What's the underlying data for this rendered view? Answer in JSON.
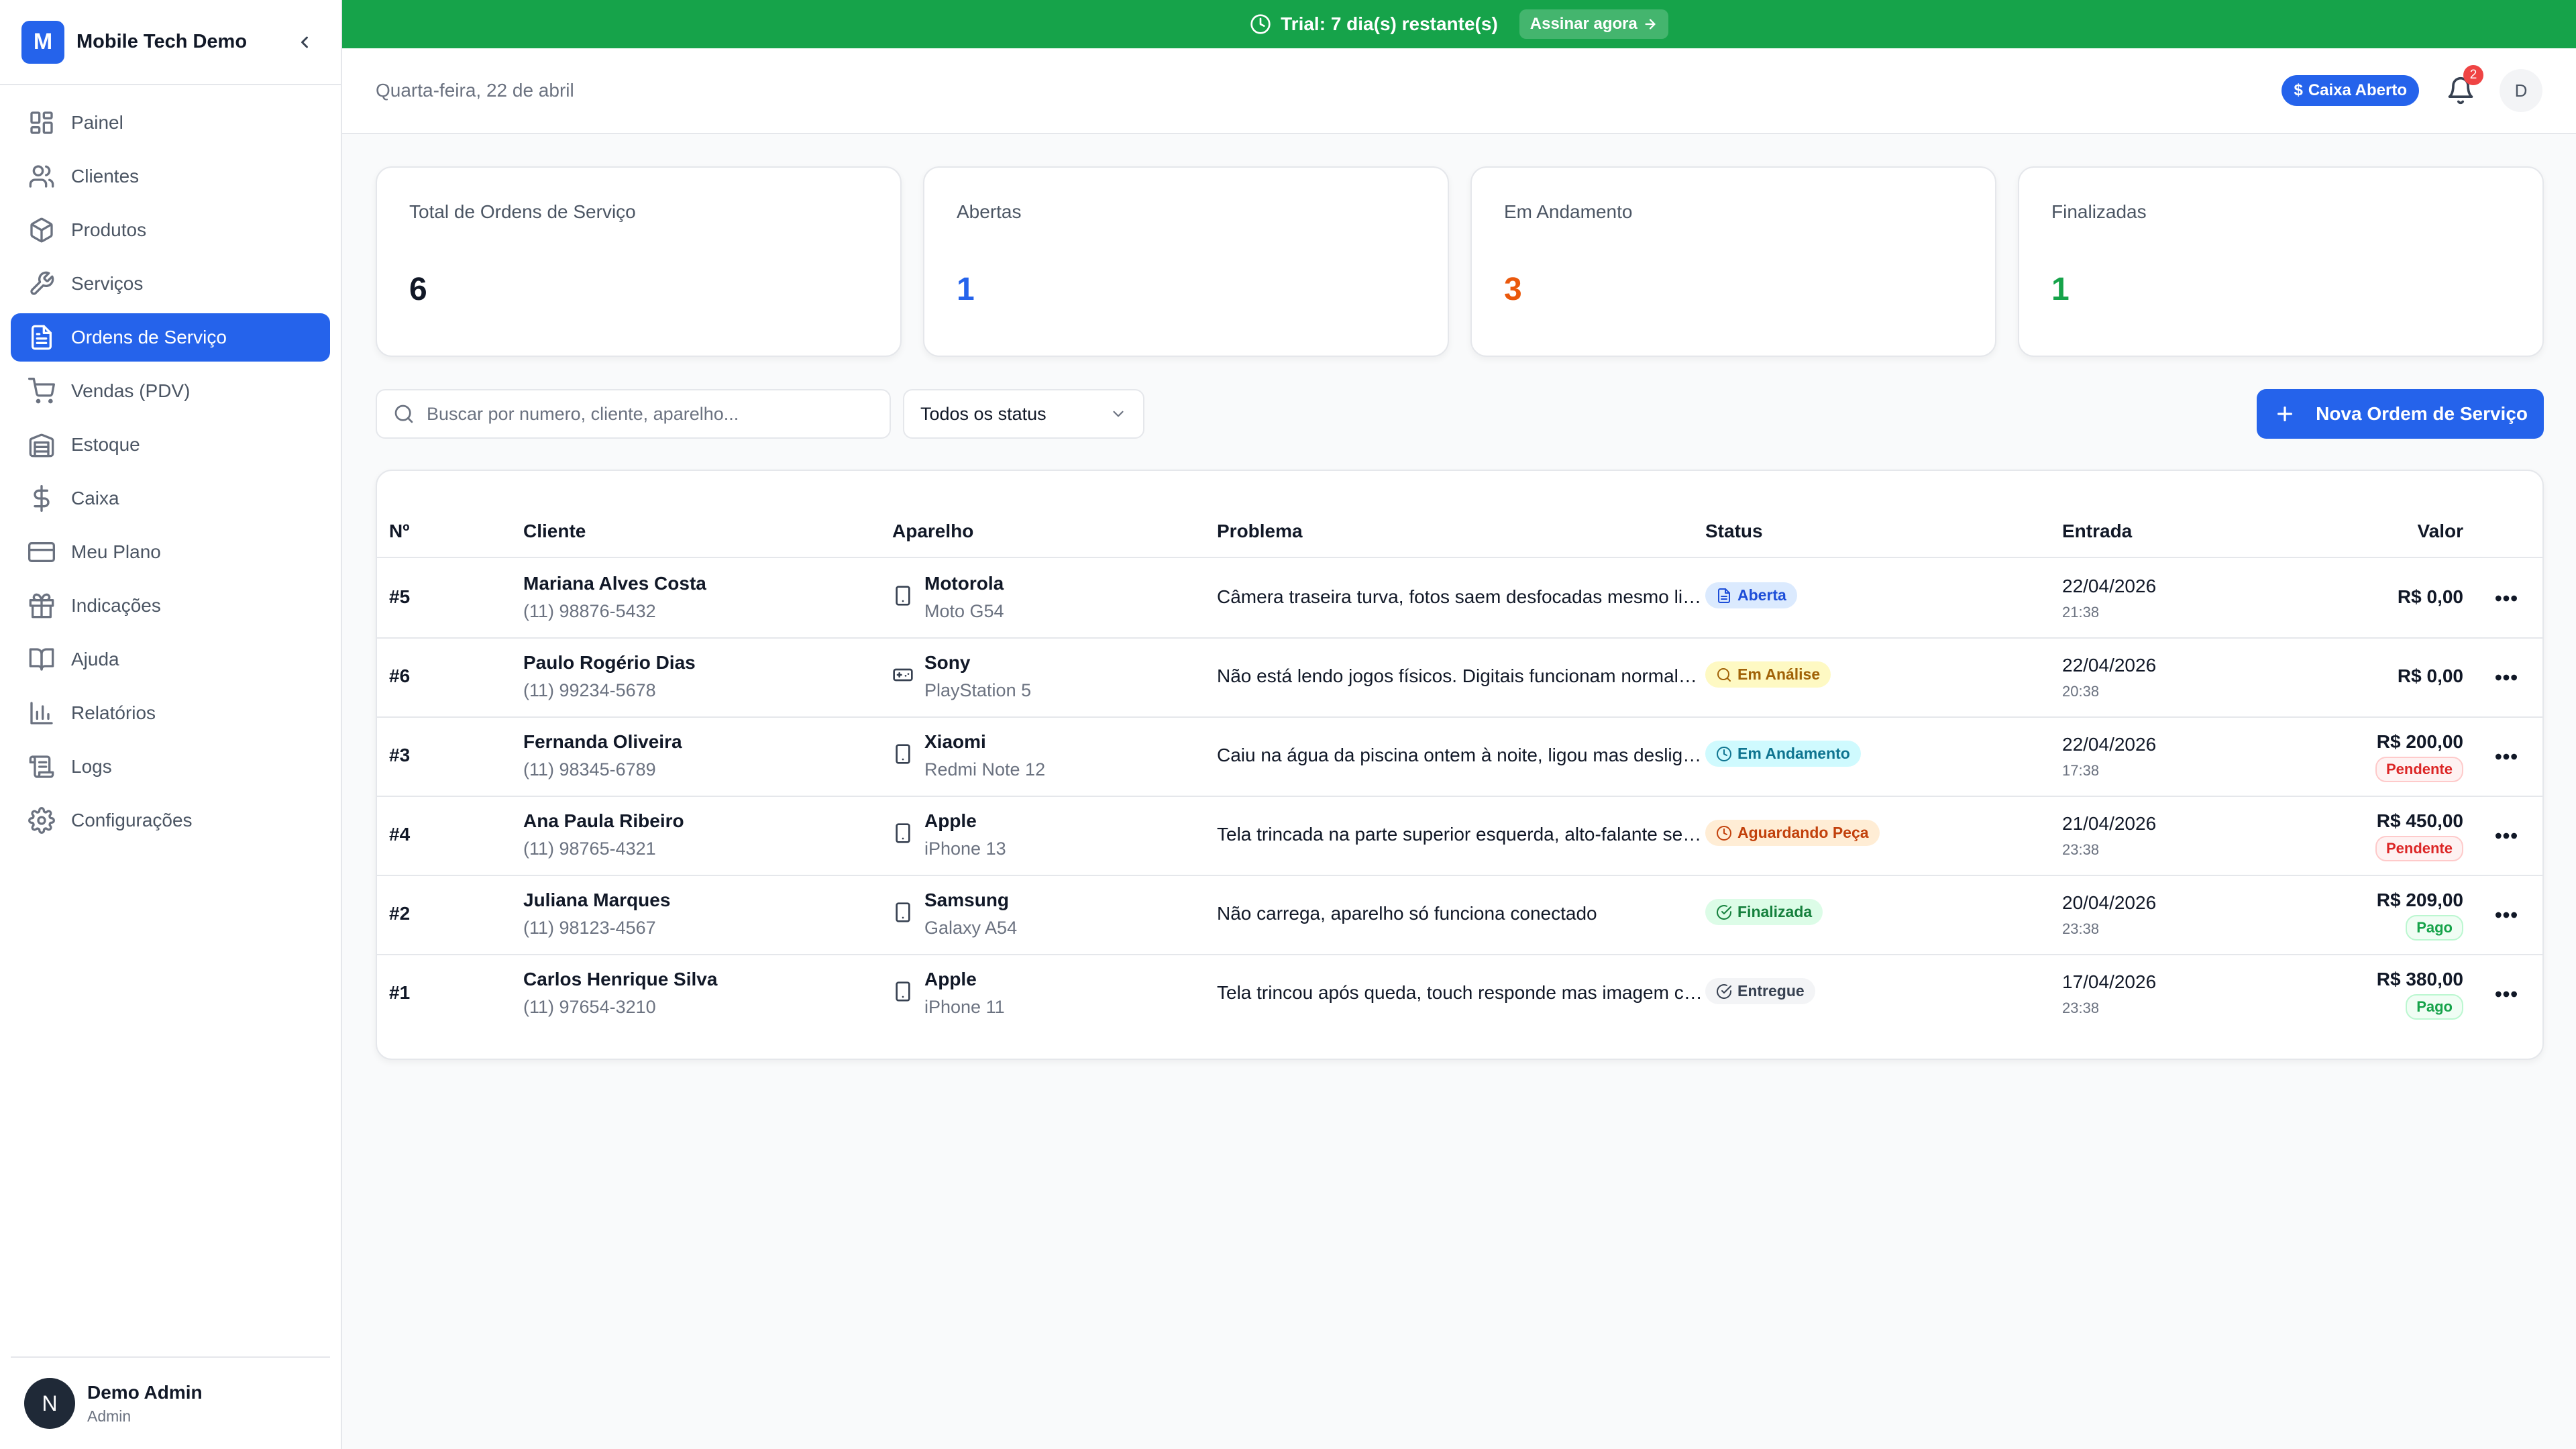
{
  "app": {
    "logo_letter": "M",
    "name": "Mobile Tech Demo"
  },
  "sidebar": {
    "items": [
      {
        "label": "Painel",
        "icon": "dashboard-icon"
      },
      {
        "label": "Clientes",
        "icon": "users-icon"
      },
      {
        "label": "Produtos",
        "icon": "package-icon"
      },
      {
        "label": "Serviços",
        "icon": "wrench-icon"
      },
      {
        "label": "Ordens de Serviço",
        "icon": "file-text-icon",
        "active": true
      },
      {
        "label": "Vendas (PDV)",
        "icon": "cart-icon"
      },
      {
        "label": "Estoque",
        "icon": "warehouse-icon"
      },
      {
        "label": "Caixa",
        "icon": "dollar-icon"
      },
      {
        "label": "Meu Plano",
        "icon": "credit-card-icon"
      },
      {
        "label": "Indicações",
        "icon": "gift-icon"
      },
      {
        "label": "Ajuda",
        "icon": "book-icon"
      },
      {
        "label": "Relatórios",
        "icon": "bar-chart-icon"
      },
      {
        "label": "Logs",
        "icon": "scroll-icon"
      },
      {
        "label": "Configurações",
        "icon": "gear-icon"
      }
    ],
    "user": {
      "initial": "N",
      "name": "Demo Admin",
      "role": "Admin"
    }
  },
  "banner": {
    "text": "Trial: 7 dia(s) restante(s)",
    "button": "Assinar agora"
  },
  "header": {
    "date": "Quarta-feira, 22 de abril",
    "caixa_badge": "Caixa Aberto",
    "notification_count": "2",
    "avatar_initial": "D"
  },
  "stats": [
    {
      "label": "Total de Ordens de Serviço",
      "value": "6",
      "color": "#111827"
    },
    {
      "label": "Abertas",
      "value": "1",
      "color": "#2563eb"
    },
    {
      "label": "Em Andamento",
      "value": "3",
      "color": "#ea580c"
    },
    {
      "label": "Finalizadas",
      "value": "1",
      "color": "#16a34a"
    }
  ],
  "toolbar": {
    "search_placeholder": "Buscar por numero, cliente, aparelho...",
    "status_filter": "Todos os status",
    "new_button": "Nova Ordem de Serviço"
  },
  "table": {
    "columns": {
      "num": "Nº",
      "client": "Cliente",
      "device": "Aparelho",
      "problem": "Problema",
      "status": "Status",
      "date": "Entrada",
      "value": "Valor"
    },
    "rows": [
      {
        "num": "#5",
        "client": "Mariana Alves Costa",
        "phone": "(11) 98876-5432",
        "brand": "Motorola",
        "model": "Moto G54",
        "device_icon": "smartphone-icon",
        "problem": "Câmera traseira turva, fotos saem desfocadas mesmo limpando a lente",
        "status": "Aberta",
        "status_icon": "file-icon",
        "date": "22/04/2026",
        "time": "21:38",
        "value": "R$ 0,00",
        "payment": ""
      },
      {
        "num": "#6",
        "client": "Paulo Rogério Dias",
        "phone": "(11) 99234-5678",
        "brand": "Sony",
        "model": "PlayStation 5",
        "device_icon": "gamepad-icon",
        "problem": "Não está lendo jogos físicos. Digitais funcionam normalmente",
        "status": "Em Análise",
        "status_icon": "search-icon",
        "date": "22/04/2026",
        "time": "20:38",
        "value": "R$ 0,00",
        "payment": ""
      },
      {
        "num": "#3",
        "client": "Fernanda Oliveira",
        "phone": "(11) 98345-6789",
        "brand": "Xiaomi",
        "model": "Redmi Note 12",
        "device_icon": "smartphone-icon",
        "problem": "Caiu na água da piscina ontem à noite, ligou mas desligou em seguida",
        "status": "Em Andamento",
        "status_icon": "clock-icon",
        "date": "22/04/2026",
        "time": "17:38",
        "value": "R$ 200,00",
        "payment": "Pendente"
      },
      {
        "num": "#4",
        "client": "Ana Paula Ribeiro",
        "phone": "(11) 98765-4321",
        "brand": "Apple",
        "model": "iPhone 13",
        "device_icon": "smartphone-icon",
        "problem": "Tela trincada na parte superior esquerda, alto-falante sem som",
        "status": "Aguardando Peça",
        "status_icon": "clock-icon",
        "date": "21/04/2026",
        "time": "23:38",
        "value": "R$ 450,00",
        "payment": "Pendente"
      },
      {
        "num": "#2",
        "client": "Juliana Marques",
        "phone": "(11) 98123-4567",
        "brand": "Samsung",
        "model": "Galaxy A54",
        "device_icon": "smartphone-icon",
        "problem": "Não carrega, aparelho só funciona conectado",
        "status": "Finalizada",
        "status_icon": "check-circle-icon",
        "date": "20/04/2026",
        "time": "23:38",
        "value": "R$ 209,00",
        "payment": "Pago"
      },
      {
        "num": "#1",
        "client": "Carlos Henrique Silva",
        "phone": "(11) 97654-3210",
        "brand": "Apple",
        "model": "iPhone 11",
        "device_icon": "smartphone-icon",
        "problem": "Tela trincou após queda, touch responde mas imagem com manchas",
        "status": "Entregue",
        "status_icon": "check-circle-icon",
        "date": "17/04/2026",
        "time": "23:38",
        "value": "R$ 380,00",
        "payment": "Pago"
      }
    ]
  },
  "colors": {
    "primary": "#2563eb",
    "banner": "#16a34a",
    "status": {
      "Aberta": {
        "bg": "#dbeafe",
        "fg": "#1d4ed8"
      },
      "Em Análise": {
        "bg": "#fef9c3",
        "fg": "#a16207"
      },
      "Em Andamento": {
        "bg": "#cffafe",
        "fg": "#0e7490"
      },
      "Aguardando Peça": {
        "bg": "#ffedd5",
        "fg": "#c2410c"
      },
      "Finalizada": {
        "bg": "#dcfce7",
        "fg": "#15803d"
      },
      "Entregue": {
        "bg": "#f3f4f6",
        "fg": "#374151"
      }
    },
    "payment": {
      "Pendente": {
        "bg": "#fef2f2",
        "fg": "#dc2626",
        "border": "#fecaca"
      },
      "Pago": {
        "bg": "#f0fdf4",
        "fg": "#16a34a",
        "border": "#bbf7d0"
      }
    }
  }
}
